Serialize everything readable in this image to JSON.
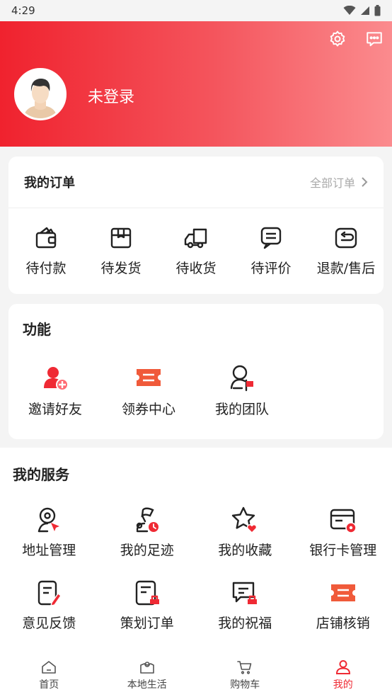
{
  "status_bar": {
    "time": "4:29"
  },
  "header": {
    "login_text": "未登录",
    "icons": [
      "settings-icon",
      "message-icon"
    ]
  },
  "orders": {
    "title": "我的订单",
    "all_orders": "全部订单",
    "items": [
      {
        "label": "待付款",
        "icon": "wallet-icon"
      },
      {
        "label": "待发货",
        "icon": "box-icon"
      },
      {
        "label": "待收货",
        "icon": "truck-icon"
      },
      {
        "label": "待评价",
        "icon": "comment-icon"
      },
      {
        "label": "退款/售后",
        "icon": "return-icon"
      }
    ]
  },
  "functions": {
    "title": "功能",
    "items": [
      {
        "label": "邀请好友",
        "icon": "invite-user-icon"
      },
      {
        "label": "领券中心",
        "icon": "coupon-icon"
      },
      {
        "label": "我的团队",
        "icon": "team-icon"
      }
    ]
  },
  "services": {
    "title": "我的服务",
    "items": [
      {
        "label": "地址管理",
        "icon": "address-icon"
      },
      {
        "label": "我的足迹",
        "icon": "footprint-icon"
      },
      {
        "label": "我的收藏",
        "icon": "favorite-star-icon"
      },
      {
        "label": "银行卡管理",
        "icon": "bank-card-icon"
      },
      {
        "label": "意见反馈",
        "icon": "feedback-icon"
      },
      {
        "label": "策划订单",
        "icon": "plan-order-icon"
      },
      {
        "label": "我的祝福",
        "icon": "blessing-icon"
      },
      {
        "label": "店铺核销",
        "icon": "store-verify-icon"
      }
    ]
  },
  "tabbar": {
    "items": [
      {
        "label": "首页",
        "icon": "home-icon"
      },
      {
        "label": "本地生活",
        "icon": "local-life-icon"
      },
      {
        "label": "购物车",
        "icon": "cart-icon"
      },
      {
        "label": "我的",
        "icon": "profile-icon"
      }
    ],
    "active": "我的"
  },
  "colors": {
    "brand_red": "#ef2a34",
    "coupon_orange": "#f05a3a",
    "text_dark": "#222222",
    "text_muted": "#aaaaaa"
  }
}
